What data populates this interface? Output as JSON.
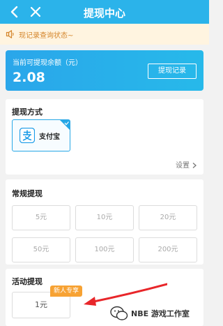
{
  "header": {
    "title": "提现中心"
  },
  "notice": {
    "text": "现记录查询状态~"
  },
  "balance": {
    "label": "当前可提现余额（元）",
    "value": "2.08",
    "records_button": "提现记录"
  },
  "methods": {
    "heading": "提现方式",
    "alipay_label": "支付宝",
    "settings_label": "设置"
  },
  "regular": {
    "heading": "常规提现",
    "amounts": [
      "5元",
      "10元",
      "20元",
      "50元",
      "100元",
      "200元"
    ]
  },
  "activity": {
    "heading": "活动提现",
    "amount": "1元",
    "badge": "新人专享"
  },
  "watermark": {
    "text": "NBE 游戏工作室"
  },
  "colors": {
    "primary": "#2bb3ea",
    "badge": "#f7a233",
    "arrow": "#e8262a",
    "notice_text": "#d4852a"
  }
}
